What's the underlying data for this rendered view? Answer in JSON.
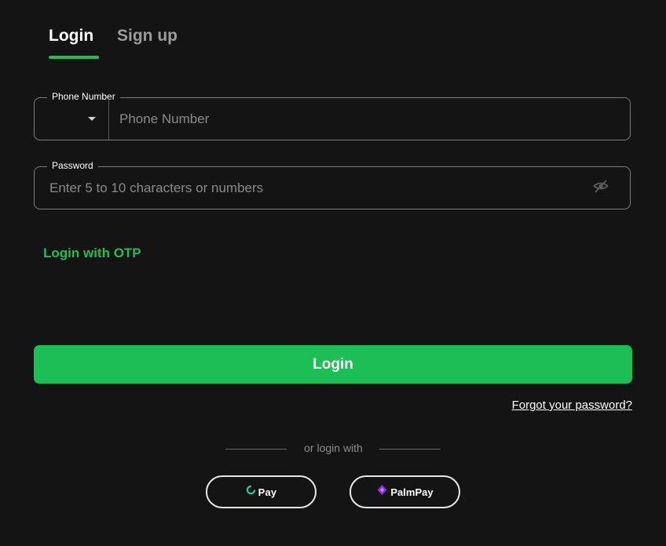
{
  "tabs": {
    "login": "Login",
    "signup": "Sign up"
  },
  "phone": {
    "label": "Phone Number",
    "placeholder": "Phone Number"
  },
  "password": {
    "label": "Password",
    "placeholder": "Enter 5 to 10 characters or numbers"
  },
  "otp_link": "Login with OTP",
  "login_button": "Login",
  "forgot_link": "Forgot your password?",
  "divider_text": "or login with",
  "providers": {
    "opay": "Pay",
    "palmpay": "PalmPay"
  },
  "colors": {
    "background": "#141414",
    "accent": "#1bbf55",
    "opay_brand": "#1dcf9f",
    "palmpay_brand": "#8a2be2"
  },
  "icons": {
    "eye": "eye-off-icon",
    "caret": "chevron-down-icon",
    "opay": "opay-logo-icon",
    "palmpay": "palmpay-logo-icon"
  }
}
